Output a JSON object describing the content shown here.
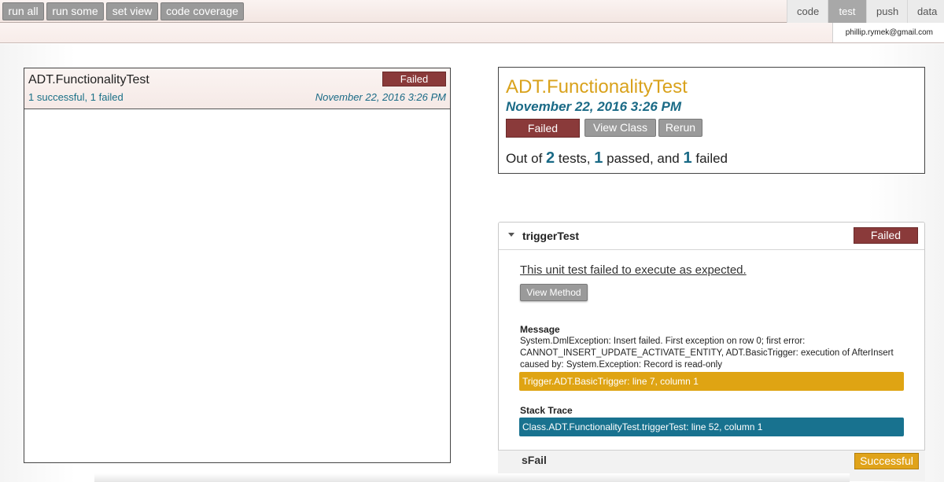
{
  "toolbar": {
    "buttons": [
      "run all",
      "run some",
      "set view",
      "code coverage"
    ]
  },
  "tabs": [
    {
      "label": "code",
      "active": false
    },
    {
      "label": "test",
      "active": true
    },
    {
      "label": "push",
      "active": false
    },
    {
      "label": "data",
      "active": false
    }
  ],
  "user": {
    "email": "phillip.rymek@gmail.com"
  },
  "left_panel": {
    "title": "ADT.FunctionalityTest",
    "status": "Failed",
    "summary": "1 successful, 1 failed",
    "date": "November 22, 2016 3:26 PM"
  },
  "detail": {
    "title": "ADT.FunctionalityTest",
    "date": "November 22, 2016 3:26 PM",
    "status": "Failed",
    "view_class_label": "View Class",
    "rerun_label": "Rerun",
    "summary": {
      "prefix": "Out of",
      "total": "2",
      "tests_word": "tests,",
      "passed": "1",
      "passed_word": "passed, and",
      "failed": "1",
      "failed_word": "failed"
    }
  },
  "test_case": {
    "name": "triggerTest",
    "status": "Failed",
    "fail_message": "This unit test failed to execute as expected.",
    "view_method_label": "View Method",
    "message_label": "Message",
    "message": "System.DmlException: Insert failed. First exception on row 0; first error: CANNOT_INSERT_UPDATE_ACTIVATE_ENTITY, ADT.BasicTrigger: execution of AfterInsert caused by: System.Exception: Record is read-only",
    "trigger_location": "Trigger.ADT.BasicTrigger: line 7, column 1",
    "stack_trace_label": "Stack Trace",
    "stack_trace": "Class.ADT.FunctionalityTest.triggerTest: line 52, column 1"
  },
  "next_case": {
    "name": "sFail",
    "status": "Successful"
  },
  "colors": {
    "failed": "#8a3a3a",
    "gold": "#dfa413",
    "teal": "#18728f",
    "title_gold": "#d9a21c"
  }
}
